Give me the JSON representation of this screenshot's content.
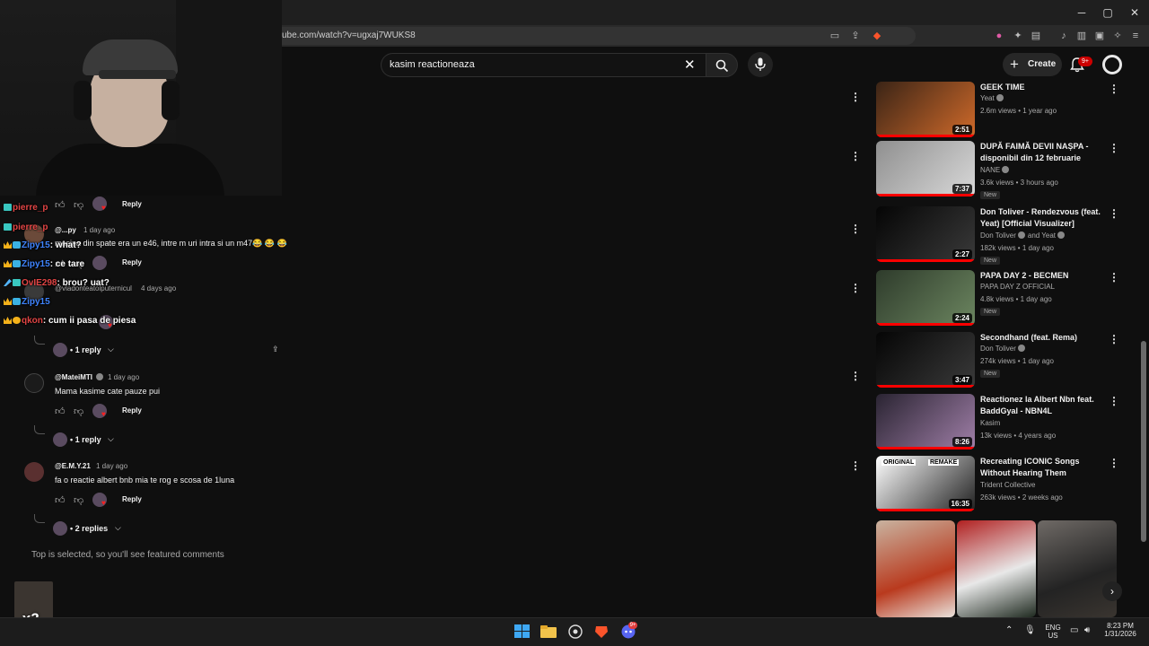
{
  "browser": {
    "url_fragment": "ube.com/watch?v=ugxaj7WUKS8",
    "minimize": "─",
    "maximize": "▢",
    "close": "✕"
  },
  "header": {
    "search_value": "kasim reactioneaza",
    "search_clear": "✕",
    "create_label": "Create",
    "create_plus": "+",
    "notifications_badge": "9+"
  },
  "chat": [
    {
      "user": "pierre_p",
      "user_color": "#e24545",
      "badges": [
        "ghost"
      ],
      "message": ""
    },
    {
      "user": "pierre_p",
      "user_color": "#e24545",
      "badges": [
        "ghost"
      ],
      "message": ""
    },
    {
      "user": "Zipy15",
      "user_color": "#3f84ff",
      "badges": [
        "crown",
        "gem"
      ],
      "message": "what?"
    },
    {
      "user": "Zipy15",
      "user_color": "#3f84ff",
      "badges": [
        "crown",
        "gem"
      ],
      "message": "ce tare"
    },
    {
      "user": "OvIE298",
      "user_color": "#e24545",
      "badges": [
        "sword",
        "ghost"
      ],
      "message": "brou? uat?"
    },
    {
      "user": "Zipy15",
      "user_color": "#3f84ff",
      "badges": [
        "crown",
        "gem"
      ],
      "message": ""
    },
    {
      "user": "qkon",
      "user_color": "#e24545",
      "badges": [
        "crown",
        "one"
      ],
      "message": "cum ii pasa de piesa"
    }
  ],
  "comments": {
    "reply_label": "Reply",
    "partial": [
      {
        "author": "@...py",
        "time": "1 day ago",
        "text": "masina din spate era un e46, intre m uri intra si un m47😂 😂 😂"
      },
      {
        "author": "@vladonteatolputernicul",
        "time": "4 days ago",
        "text": ""
      }
    ],
    "thread1_replies": "1 reply",
    "items": [
      {
        "author": "@MateiMTI",
        "time": "1 day ago",
        "text": "Mama kasime cate pauze pui",
        "replies": "1 reply"
      },
      {
        "author": "@E.M.Y.21",
        "time": "1 day ago",
        "text": "fa o reactie albert bnb mia te rog e scosa de 1luna",
        "replies": "2 replies"
      }
    ],
    "footer_note": "Top is selected, so you'll see featured comments"
  },
  "related": [
    {
      "title": "GEEK TIME",
      "channel": "Yeat",
      "verified": true,
      "meta": "2.6m views • 1 year ago",
      "duration": "2:51",
      "is_new": false,
      "colors": [
        "#3a2416",
        "#d06a2a"
      ]
    },
    {
      "title": "DUPĂ FAIMĂ DEVII NAȘPA - disponibil din 12 februarie",
      "channel": "NANE",
      "verified": true,
      "meta": "3.6k views • 3 hours ago",
      "duration": "7:37",
      "is_new": true,
      "colors": [
        "#8f8f8f",
        "#d9d9d9"
      ]
    },
    {
      "title": "Don Toliver - Rendezvous (feat. Yeat) [Official Visualizer]",
      "channel": "Don Toliver",
      "channel_extra": "and Yeat",
      "verified": true,
      "meta": "182k views • 1 day ago",
      "duration": "2:27",
      "is_new": true,
      "colors": [
        "#050505",
        "#3a3a3a"
      ]
    },
    {
      "title": "PAPA DAY 2 - BECMEN",
      "channel": "PAPA DAY Z OFFICIAL",
      "verified": false,
      "meta": "4.8k views • 1 day ago",
      "duration": "2:24",
      "is_new": true,
      "colors": [
        "#2e3b2b",
        "#6c8660"
      ]
    },
    {
      "title": "Secondhand (feat. Rema)",
      "channel": "Don Toliver",
      "verified": true,
      "meta": "274k views • 1 day ago",
      "duration": "3:47",
      "is_new": true,
      "colors": [
        "#050505",
        "#3a3a3a"
      ]
    },
    {
      "title": "Reactionez la Albert Nbn feat. BaddGyal - NBN4L",
      "channel": "Kasim",
      "verified": false,
      "meta": "13k views • 4 years ago",
      "duration": "8:26",
      "is_new": false,
      "colors": [
        "#2a2432",
        "#a07fa8"
      ]
    },
    {
      "title": "Recreating ICONIC Songs Without Hearing Them",
      "channel": "Trident Collective",
      "verified": false,
      "meta": "263k views • 2 weeks ago",
      "duration": "16:35",
      "is_new": false,
      "thumb_labels": [
        "ORIGINAL",
        "REMAKE"
      ],
      "colors": [
        "#ffffff",
        "#202020"
      ]
    }
  ],
  "overlay": {
    "multiplier": "x2"
  },
  "taskbar": {
    "lang_top": "ENG",
    "lang_bottom": "US",
    "time": "8:23 PM",
    "date": "1/31/2026",
    "discord_badge": "9+"
  }
}
